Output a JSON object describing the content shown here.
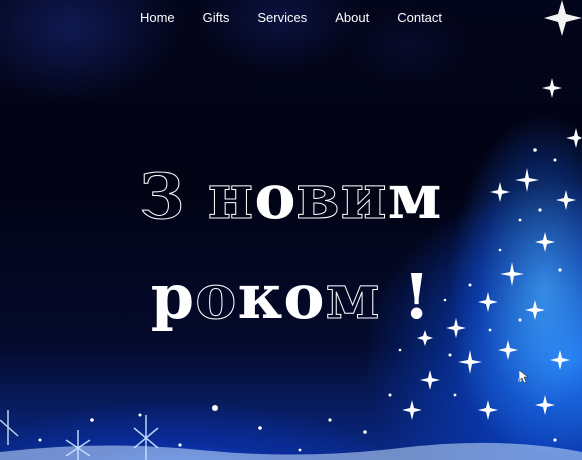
{
  "nav": {
    "items": [
      {
        "label": "Home"
      },
      {
        "label": "Gifts"
      },
      {
        "label": "Services"
      },
      {
        "label": "About"
      },
      {
        "label": "Contact"
      }
    ]
  },
  "greeting": {
    "line1_a": "З ",
    "line1_b": "н",
    "line1_c": "о",
    "line1_d": "в",
    "line1_e": "и",
    "line1_f": "м",
    "line2_a": "р",
    "line2_b": "о",
    "line2_c": "к",
    "line2_d": "о",
    "line2_e": "м",
    "line2_f": " !"
  },
  "colors": {
    "background": "#02030f",
    "glow": "#1e6eff",
    "text": "#ffffff"
  },
  "icons": {
    "cursor": "mouse-cursor-icon"
  }
}
